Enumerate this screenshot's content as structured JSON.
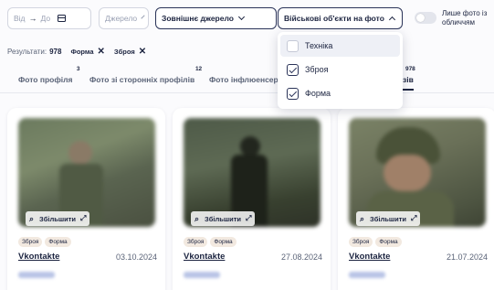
{
  "filters": {
    "date_from": "Від",
    "date_to": "До",
    "source": "Джерело",
    "external_source": "Зовнішнє джерело",
    "military_objects": "Військові об'єкти на фото",
    "faces_only_label": "Лише фото із обличчям"
  },
  "results": {
    "label": "Результати:",
    "count": "978",
    "chips": [
      "Форма",
      "Зброя"
    ]
  },
  "dropdown": {
    "options": [
      {
        "label": "Техніка",
        "checked": false
      },
      {
        "label": "Зброя",
        "checked": true
      },
      {
        "label": "Форма",
        "checked": true
      }
    ]
  },
  "tabs": [
    {
      "label": "Фото профіля",
      "count": "3"
    },
    {
      "label": "Фото зі сторонніх профілів",
      "count": "12"
    },
    {
      "label": "Фото інфлюенсер",
      "count": ""
    },
    {
      "label": "зів",
      "count": "978"
    }
  ],
  "cards": [
    {
      "zoom_label": "Збільшити",
      "tags": [
        "Зброя",
        "Форма"
      ],
      "source": "Vkontakte",
      "date": "03.10.2024"
    },
    {
      "zoom_label": "Збільшити",
      "tags": [
        "Зброя",
        "Форма"
      ],
      "source": "Vkontakte",
      "date": "27.08.2024"
    },
    {
      "zoom_label": "Збільшити",
      "tags": [
        "Зброя",
        "Форма"
      ],
      "source": "Vkontakte",
      "date": "21.07.2024"
    }
  ],
  "colors": {
    "accent": "#2a3358",
    "tag_bg": "#f2e9e0"
  }
}
